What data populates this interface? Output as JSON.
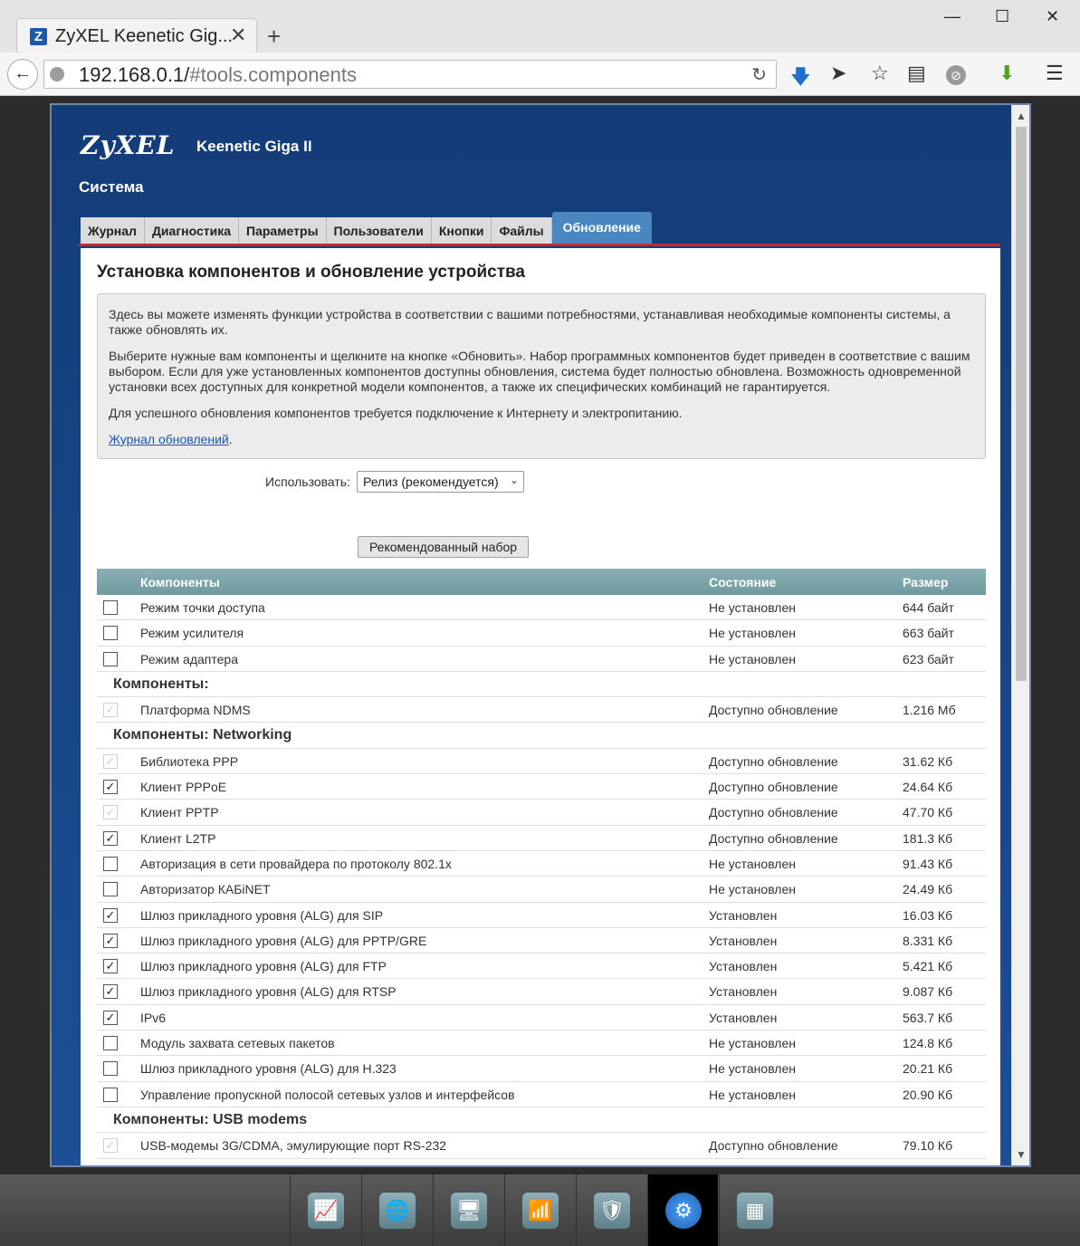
{
  "browser": {
    "tab_title": "ZyXEL Keenetic Gig...",
    "tab_close": "✕",
    "new_tab": "+",
    "url_host": "192.168.0.1/",
    "url_path": "#tools.components",
    "win_minimize": "—",
    "win_maximize": "☐",
    "win_close": "✕"
  },
  "header": {
    "brand": "ZyXEL",
    "model": "Keenetic Giga II",
    "section": "Система"
  },
  "tabs": [
    "Журнал",
    "Диагностика",
    "Параметры",
    "Пользователи",
    "Кнопки",
    "Файлы",
    "Обновление"
  ],
  "content": {
    "title": "Установка компонентов и обновление устройства",
    "info_p1": "Здесь вы можете изменять функции устройства в соответствии с вашими потребностями, устанавливая необходимые компоненты системы, а также обновлять их.",
    "info_p2": "Выберите нужные вам компоненты и щелкните на кнопке «Обновить». Набор программных компонентов будет приведен в соответствие с вашим выбором. Если для уже установленных компонентов доступны обновления, система будет полностью обновлена. Возможность одновременной установки всех доступных для конкретной модели компонентов, а также их специфических комбинаций не гарантируется.",
    "info_p3": "Для успешного обновления компонентов требуется подключение к Интернету и электропитанию.",
    "log_link": "Журнал обновлений",
    "log_link_suffix": ".",
    "use_label": "Использовать:",
    "use_value": "Релиз (рекомендуется)",
    "recommended_button": "Рекомендованный набор"
  },
  "table": {
    "col_components": "Компоненты",
    "col_state": "Состояние",
    "col_size": "Размер",
    "rows": [
      {
        "type": "item",
        "checked": false,
        "disabled": false,
        "name": "Режим точки доступа",
        "state": "Не установлен",
        "size": "644 байт"
      },
      {
        "type": "item",
        "checked": false,
        "disabled": false,
        "name": "Режим усилителя",
        "state": "Не установлен",
        "size": "663 байт"
      },
      {
        "type": "item",
        "checked": false,
        "disabled": false,
        "name": "Режим адаптера",
        "state": "Не установлен",
        "size": "623 байт"
      },
      {
        "type": "group",
        "name": "Компоненты:"
      },
      {
        "type": "item",
        "checked": true,
        "disabled": true,
        "name": "Платформа NDMS",
        "state": "Доступно обновление",
        "size": "1.216 Мб"
      },
      {
        "type": "group",
        "name": "Компоненты: Networking"
      },
      {
        "type": "item",
        "checked": true,
        "disabled": true,
        "name": "Библиотека PPP",
        "state": "Доступно обновление",
        "size": "31.62 Кб"
      },
      {
        "type": "item",
        "checked": true,
        "disabled": false,
        "name": "Клиент PPPoE",
        "state": "Доступно обновление",
        "size": "24.64 Кб"
      },
      {
        "type": "item",
        "checked": true,
        "disabled": true,
        "name": "Клиент PPTP",
        "state": "Доступно обновление",
        "size": "47.70 Кб"
      },
      {
        "type": "item",
        "checked": true,
        "disabled": false,
        "name": "Клиент L2TP",
        "state": "Доступно обновление",
        "size": "181.3 Кб"
      },
      {
        "type": "item",
        "checked": false,
        "disabled": false,
        "name": "Авторизация в сети провайдера по протоколу 802.1x",
        "state": "Не установлен",
        "size": "91.43 Кб"
      },
      {
        "type": "item",
        "checked": false,
        "disabled": false,
        "name": "Авторизатор КАБiNET",
        "state": "Не установлен",
        "size": "24.49 Кб"
      },
      {
        "type": "item",
        "checked": true,
        "disabled": false,
        "name": "Шлюз прикладного уровня (ALG) для SIP",
        "state": "Установлен",
        "size": "16.03 Кб"
      },
      {
        "type": "item",
        "checked": true,
        "disabled": false,
        "name": "Шлюз прикладного уровня (ALG) для PPTP/GRE",
        "state": "Установлен",
        "size": "8.331 Кб"
      },
      {
        "type": "item",
        "checked": true,
        "disabled": false,
        "name": "Шлюз прикладного уровня (ALG) для FTP",
        "state": "Установлен",
        "size": "5.421 Кб"
      },
      {
        "type": "item",
        "checked": true,
        "disabled": false,
        "name": "Шлюз прикладного уровня (ALG) для RTSP",
        "state": "Установлен",
        "size": "9.087 Кб"
      },
      {
        "type": "item",
        "checked": true,
        "disabled": false,
        "name": "IPv6",
        "state": "Установлен",
        "size": "563.7 Кб"
      },
      {
        "type": "item",
        "checked": false,
        "disabled": false,
        "name": "Модуль захвата сетевых пакетов",
        "state": "Не установлен",
        "size": "124.8 Кб"
      },
      {
        "type": "item",
        "checked": false,
        "disabled": false,
        "name": "Шлюз прикладного уровня (ALG) для H.323",
        "state": "Не установлен",
        "size": "20.21 Кб"
      },
      {
        "type": "item",
        "checked": false,
        "disabled": false,
        "name": "Управление пропускной полосой сетевых узлов и интерфейсов",
        "state": "Не установлен",
        "size": "20.90 Кб"
      },
      {
        "type": "group",
        "name": "Компоненты: USB modems"
      },
      {
        "type": "item",
        "checked": true,
        "disabled": true,
        "name": "USB-модемы 3G/CDMA, эмулирующие порт RS-232",
        "state": "Доступно обновление",
        "size": "79.10 Кб"
      }
    ]
  },
  "dock": {
    "items": [
      {
        "name": "monitor-icon",
        "glyph": "📈",
        "active": false
      },
      {
        "name": "internet-globe-icon",
        "glyph": "🌐",
        "active": false
      },
      {
        "name": "home-network-icon",
        "glyph": "🖥",
        "active": false
      },
      {
        "name": "wifi-signal-icon",
        "glyph": "📶",
        "active": false
      },
      {
        "name": "security-shield-icon",
        "glyph": "🛡",
        "active": false
      },
      {
        "name": "system-gear-icon",
        "glyph": "⚙",
        "active": true
      },
      {
        "name": "applications-icon",
        "glyph": "▦",
        "active": false
      }
    ]
  }
}
